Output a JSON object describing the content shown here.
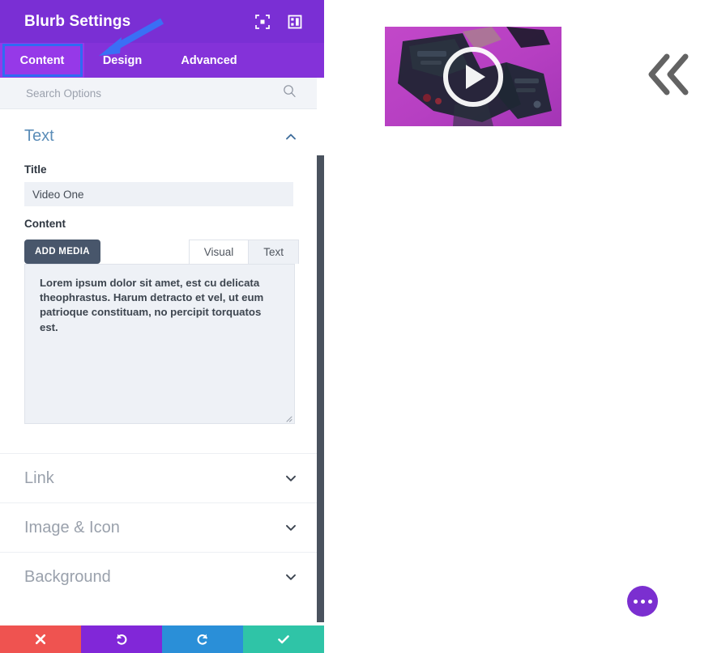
{
  "panel": {
    "title": "Blurb Settings",
    "header_icons": [
      {
        "name": "fullscreen-icon",
        "label": "Fullscreen"
      },
      {
        "name": "layout-toggle-icon",
        "label": "Toggle Layout"
      }
    ],
    "tabs": [
      {
        "label": "Content",
        "active": true
      },
      {
        "label": "Design",
        "active": false
      },
      {
        "label": "Advanced",
        "active": false
      }
    ],
    "search": {
      "placeholder": "Search Options",
      "value": "",
      "icon": "search-icon"
    },
    "sections": [
      {
        "title": "Text",
        "expanded": true,
        "chevron": "chevron-up-icon",
        "fields": {
          "title_label": "Title",
          "title_value": "Video One",
          "content_label": "Content"
        },
        "editor": {
          "add_media_label": "ADD MEDIA",
          "mode_tabs": [
            {
              "label": "Visual",
              "active": false
            },
            {
              "label": "Text",
              "active": true
            }
          ],
          "body": "Lorem ipsum dolor sit amet, est cu delicata theophrastus. Harum detracto et vel, ut eum patrioque constituam, no percipit torquatos est."
        }
      },
      {
        "title": "Link",
        "expanded": false,
        "chevron": "chevron-down-icon"
      },
      {
        "title": "Image & Icon",
        "expanded": false,
        "chevron": "chevron-down-icon"
      },
      {
        "title": "Background",
        "expanded": false,
        "chevron": "chevron-down-icon"
      }
    ],
    "action_bar": [
      {
        "name": "cancel-button",
        "icon": "close-icon",
        "color": "#ef5350"
      },
      {
        "name": "undo-button",
        "icon": "undo-icon",
        "color": "#8127d8"
      },
      {
        "name": "redo-button",
        "icon": "redo-icon",
        "color": "#2a8fd8"
      },
      {
        "name": "save-button",
        "icon": "check-icon",
        "color": "#2fc4a7"
      }
    ],
    "scrollbar": {
      "name": "panel-scrollbar"
    }
  },
  "canvas": {
    "video_module": {
      "name": "video-thumbnail",
      "play_icon": "play-icon",
      "background_color": "#b93fc4"
    },
    "collapse_icon": "chevron-double-left-icon",
    "fab": {
      "name": "more-options-button",
      "icon": "ellipsis-icon",
      "color": "#7b2fd0"
    }
  },
  "annotations": {
    "highlight_color": "#2f6bf2",
    "arrow_target": "Content"
  }
}
